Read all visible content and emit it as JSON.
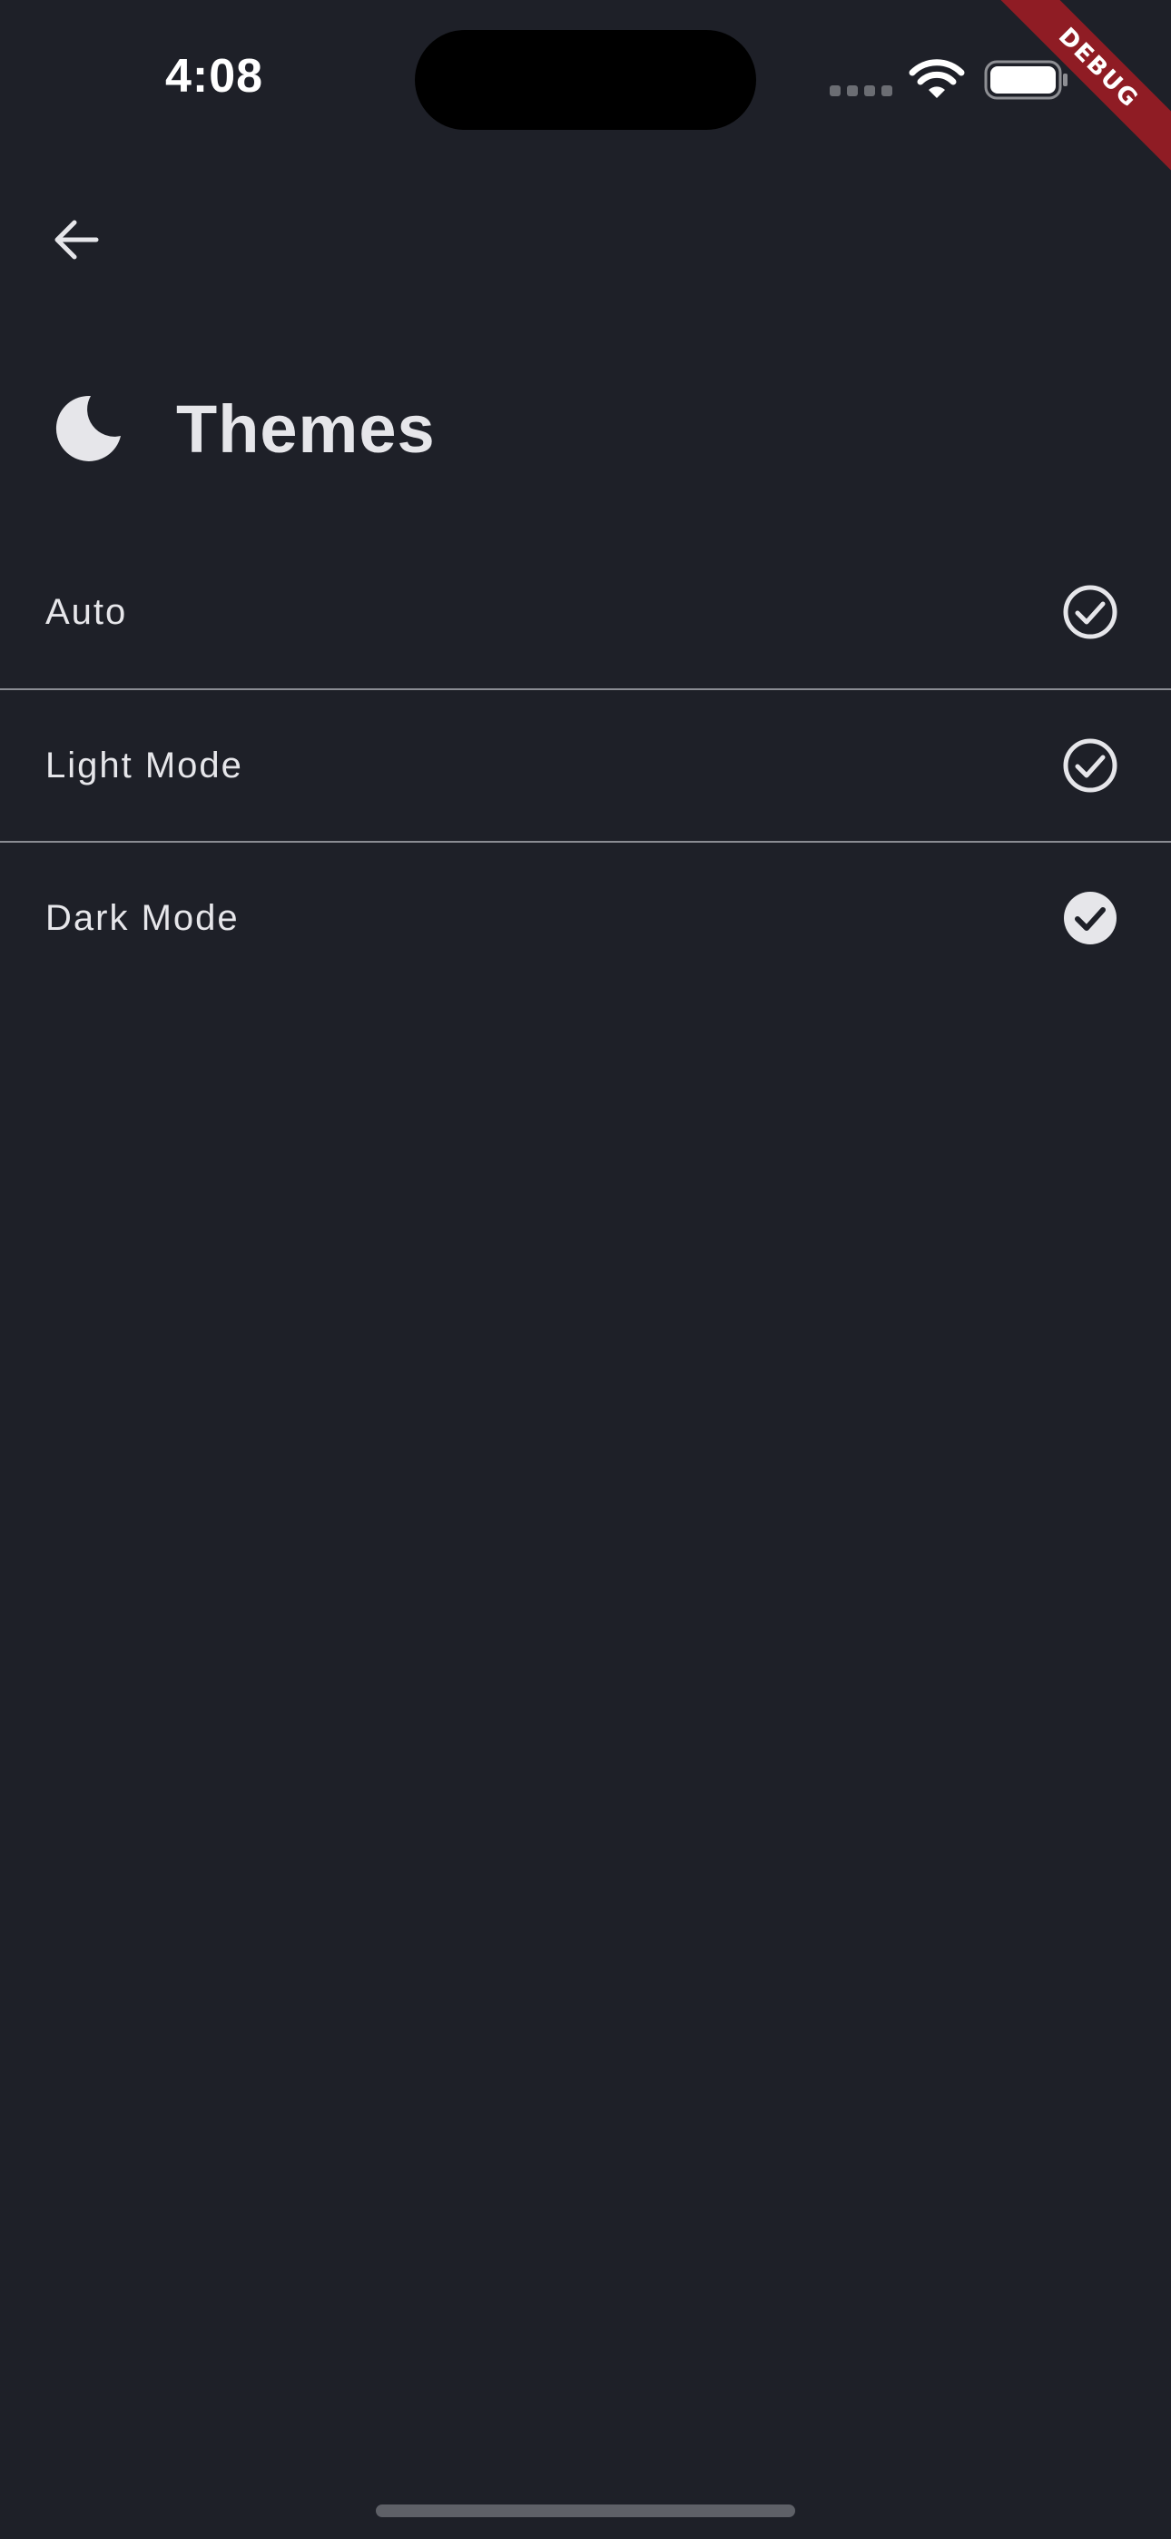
{
  "status_bar": {
    "time": "4:08",
    "icons": [
      "signal-dots-icon",
      "wifi-icon",
      "battery-icon"
    ]
  },
  "debug_banner": {
    "label": "DEBUG",
    "color": "#8f1c24"
  },
  "navigation": {
    "back_icon": "arrow-left-icon"
  },
  "header": {
    "icon": "moon-icon",
    "title": "Themes"
  },
  "themes": {
    "items": [
      {
        "label": "Auto",
        "selected": false
      },
      {
        "label": "Light Mode",
        "selected": false
      },
      {
        "label": "Dark Mode",
        "selected": true
      }
    ]
  },
  "colors": {
    "background": "#1e2028",
    "text": "#e6e6ea",
    "divider": "#8a8c93"
  }
}
